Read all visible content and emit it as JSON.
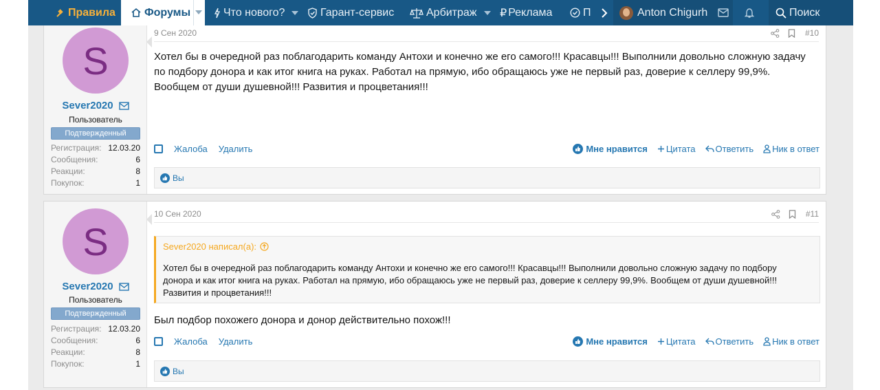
{
  "nav": {
    "rules": "Правила",
    "forums": "Форумы",
    "whats_new": "Что нового?",
    "garant": "Гарант-сервис",
    "arbitrage": "Арбитраж",
    "ads": "Реклама",
    "more": "П",
    "user": "Anton Chigurh",
    "search": "Поиск"
  },
  "posts": [
    {
      "date": "9 Сен 2020",
      "number": "#10",
      "avatar_letter": "S",
      "username": "Sever2020",
      "user_title": "Пользователь",
      "banner": "Подтвержденный",
      "stats": [
        {
          "k": "Регистрация:",
          "v": "12.03.20"
        },
        {
          "k": "Сообщения:",
          "v": "6"
        },
        {
          "k": "Реакции:",
          "v": "8"
        },
        {
          "k": "Покупок:",
          "v": "1"
        }
      ],
      "message": "Хотел бы в очередной раз поблагодарить команду Антохи и конечно же его самого!!! Красавцы!!! Выполнили довольно сложную задачу по подбору донора и как итог книга на руках. Работал на прямую, ибо обращаюсь уже не первый раз, доверие к селлеру 99,9%. Вообщем от души душевной!!! Развития и процветания!!!",
      "reactions": "Вы"
    },
    {
      "date": "10 Сен 2020",
      "number": "#11",
      "avatar_letter": "S",
      "username": "Sever2020",
      "user_title": "Пользователь",
      "banner": "Подтвержденный",
      "stats": [
        {
          "k": "Регистрация:",
          "v": "12.03.20"
        },
        {
          "k": "Сообщения:",
          "v": "6"
        },
        {
          "k": "Реакции:",
          "v": "8"
        },
        {
          "k": "Покупок:",
          "v": "1"
        }
      ],
      "quote_author": "Sever2020 написал(а):",
      "quote_text": "Хотел бы в очередной раз поблагодарить команду Антохи и конечно же его самого!!! Красавцы!!! Выполнили довольно сложную задачу по подбору донора и как итог книга на руках. Работал на прямую, ибо обращаюсь уже не первый раз, доверие к селлеру 99,9%. Вообщем от души душевной!!! Развития и процветания!!!",
      "message": "Был подбор похожего донора и донор действительно похож!!!",
      "reactions": "Вы"
    }
  ],
  "actions": {
    "report": "Жалоба",
    "delete": "Удалить",
    "like": "Мне нравится",
    "quote": "Цитата",
    "reply": "Ответить",
    "mention": "Ник в ответ"
  },
  "icons": [
    "gavel-icon",
    "home-icon",
    "bolt-icon",
    "shield-check-icon",
    "scales-icon",
    "ruble-icon",
    "check-circle-icon",
    "chevron-right-icon",
    "avatar",
    "envelope-icon",
    "bell-icon",
    "search-icon",
    "share-icon",
    "bookmark-icon",
    "like-icon",
    "plus-icon",
    "reply-icon",
    "user-icon",
    "arrow-up-icon"
  ],
  "colors": {
    "nav_bg": "#185886",
    "accent": "#2577b1",
    "rules": "#f7b13a",
    "quote_border": "#f5a81f",
    "avatar_bg": "#d19ad4",
    "banner_bg": "#83a8cd"
  }
}
